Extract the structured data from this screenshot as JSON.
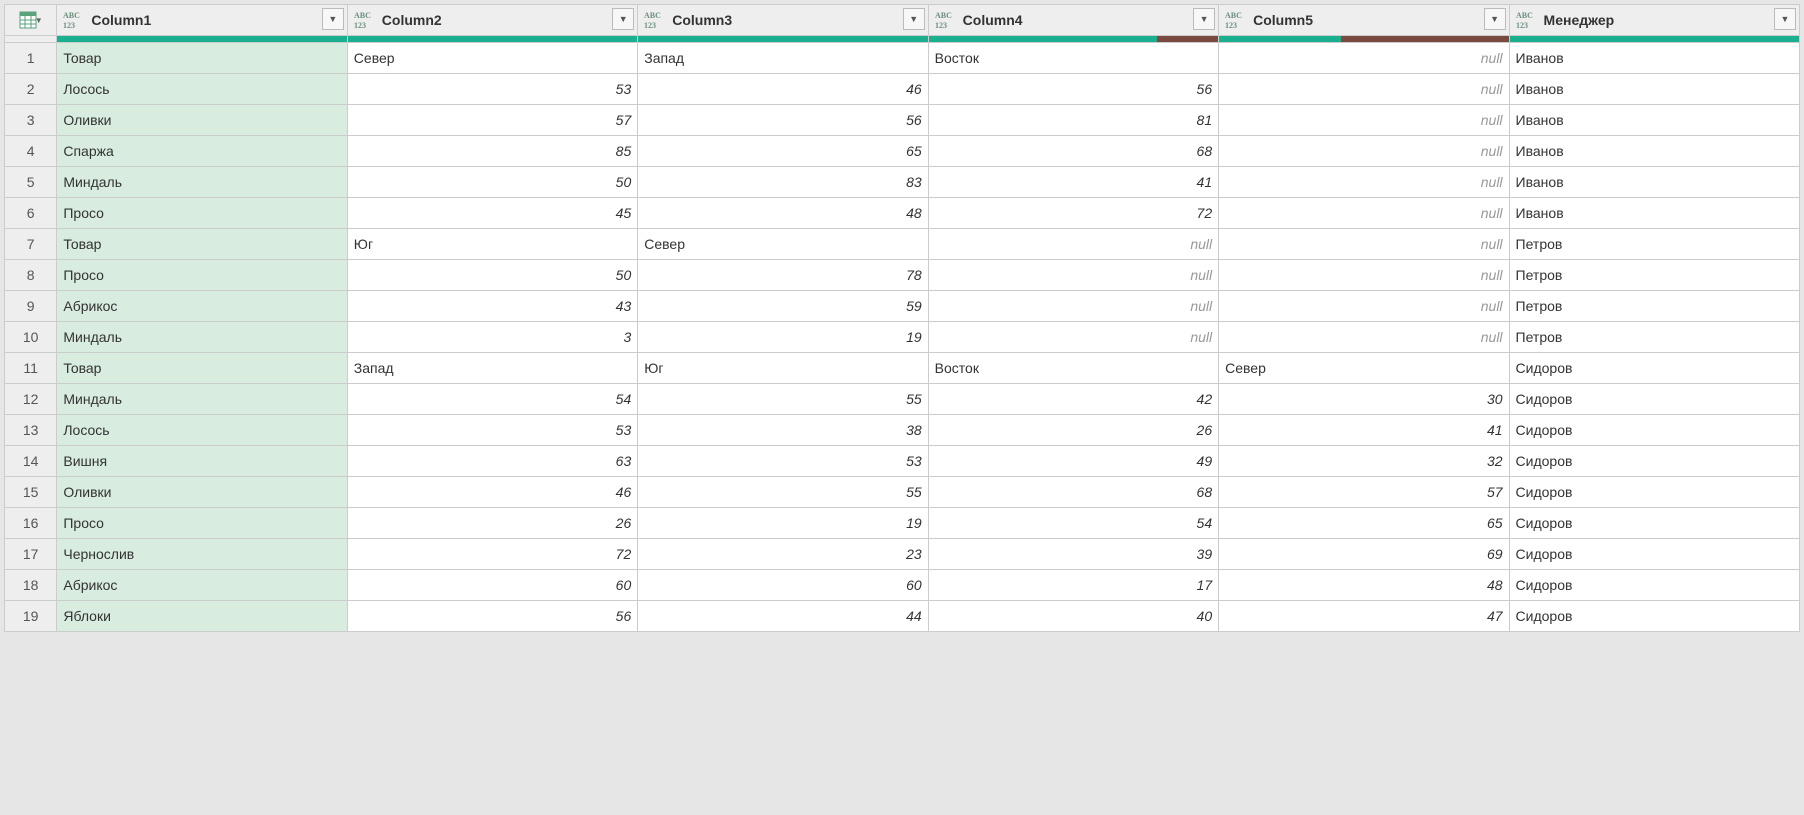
{
  "null_label": "null",
  "columns": [
    {
      "name": "Column1",
      "type_icon": "abc123"
    },
    {
      "name": "Column2",
      "type_icon": "abc123"
    },
    {
      "name": "Column3",
      "type_icon": "abc123"
    },
    {
      "name": "Column4",
      "type_icon": "abc123"
    },
    {
      "name": "Column5",
      "type_icon": "abc123"
    },
    {
      "name": "Менеджер",
      "type_icon": "abc123"
    }
  ],
  "quality": [
    {
      "green": 1.0,
      "brown": 0.0
    },
    {
      "green": 1.0,
      "brown": 0.0
    },
    {
      "green": 1.0,
      "brown": 0.0
    },
    {
      "green": 0.79,
      "brown": 0.21
    },
    {
      "green": 0.42,
      "brown": 0.58
    },
    {
      "green": 1.0,
      "brown": 0.0
    }
  ],
  "rows": [
    {
      "n": 1,
      "c": [
        "Товар",
        "Север",
        "Запад",
        "Восток",
        null,
        "Иванов"
      ],
      "types": [
        "t",
        "t",
        "t",
        "t",
        "n",
        "t"
      ]
    },
    {
      "n": 2,
      "c": [
        "Лосось",
        53,
        46,
        56,
        null,
        "Иванов"
      ],
      "types": [
        "t",
        "i",
        "i",
        "i",
        "n",
        "t"
      ]
    },
    {
      "n": 3,
      "c": [
        "Оливки",
        57,
        56,
        81,
        null,
        "Иванов"
      ],
      "types": [
        "t",
        "i",
        "i",
        "i",
        "n",
        "t"
      ]
    },
    {
      "n": 4,
      "c": [
        "Спаржа",
        85,
        65,
        68,
        null,
        "Иванов"
      ],
      "types": [
        "t",
        "i",
        "i",
        "i",
        "n",
        "t"
      ]
    },
    {
      "n": 5,
      "c": [
        "Миндаль",
        50,
        83,
        41,
        null,
        "Иванов"
      ],
      "types": [
        "t",
        "i",
        "i",
        "i",
        "n",
        "t"
      ]
    },
    {
      "n": 6,
      "c": [
        "Просо",
        45,
        48,
        72,
        null,
        "Иванов"
      ],
      "types": [
        "t",
        "i",
        "i",
        "i",
        "n",
        "t"
      ]
    },
    {
      "n": 7,
      "c": [
        "Товар",
        "Юг",
        "Север",
        null,
        null,
        "Петров"
      ],
      "types": [
        "t",
        "t",
        "t",
        "n",
        "n",
        "t"
      ]
    },
    {
      "n": 8,
      "c": [
        "Просо",
        50,
        78,
        null,
        null,
        "Петров"
      ],
      "types": [
        "t",
        "i",
        "i",
        "n",
        "n",
        "t"
      ]
    },
    {
      "n": 9,
      "c": [
        "Абрикос",
        43,
        59,
        null,
        null,
        "Петров"
      ],
      "types": [
        "t",
        "i",
        "i",
        "n",
        "n",
        "t"
      ]
    },
    {
      "n": 10,
      "c": [
        "Миндаль",
        3,
        19,
        null,
        null,
        "Петров"
      ],
      "types": [
        "t",
        "i",
        "i",
        "n",
        "n",
        "t"
      ]
    },
    {
      "n": 11,
      "c": [
        "Товар",
        "Запад",
        "Юг",
        "Восток",
        "Север",
        "Сидоров"
      ],
      "types": [
        "t",
        "t",
        "t",
        "t",
        "t",
        "t"
      ]
    },
    {
      "n": 12,
      "c": [
        "Миндаль",
        54,
        55,
        42,
        30,
        "Сидоров"
      ],
      "types": [
        "t",
        "i",
        "i",
        "i",
        "i",
        "t"
      ]
    },
    {
      "n": 13,
      "c": [
        "Лосось",
        53,
        38,
        26,
        41,
        "Сидоров"
      ],
      "types": [
        "t",
        "i",
        "i",
        "i",
        "i",
        "t"
      ]
    },
    {
      "n": 14,
      "c": [
        "Вишня",
        63,
        53,
        49,
        32,
        "Сидоров"
      ],
      "types": [
        "t",
        "i",
        "i",
        "i",
        "i",
        "t"
      ]
    },
    {
      "n": 15,
      "c": [
        "Оливки",
        46,
        55,
        68,
        57,
        "Сидоров"
      ],
      "types": [
        "t",
        "i",
        "i",
        "i",
        "i",
        "t"
      ]
    },
    {
      "n": 16,
      "c": [
        "Просо",
        26,
        19,
        54,
        65,
        "Сидоров"
      ],
      "types": [
        "t",
        "i",
        "i",
        "i",
        "i",
        "t"
      ]
    },
    {
      "n": 17,
      "c": [
        "Чернослив",
        72,
        23,
        39,
        69,
        "Сидоров"
      ],
      "types": [
        "t",
        "i",
        "i",
        "i",
        "i",
        "t"
      ]
    },
    {
      "n": 18,
      "c": [
        "Абрикос",
        60,
        60,
        17,
        48,
        "Сидоров"
      ],
      "types": [
        "t",
        "i",
        "i",
        "i",
        "i",
        "t"
      ]
    },
    {
      "n": 19,
      "c": [
        "Яблоки",
        56,
        44,
        40,
        47,
        "Сидоров"
      ],
      "types": [
        "t",
        "i",
        "i",
        "i",
        "i",
        "t"
      ]
    }
  ]
}
